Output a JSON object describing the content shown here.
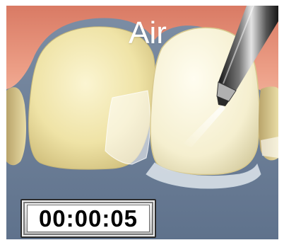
{
  "step": {
    "label": "Air"
  },
  "timer": {
    "value": "00:00:05"
  },
  "colors": {
    "gum": "#e8967f",
    "background": "#6c7f98",
    "tooth": "#f1e8b2",
    "veneer": "#f7f2d8"
  },
  "icons": {
    "instrument": "air-syringe-icon"
  }
}
